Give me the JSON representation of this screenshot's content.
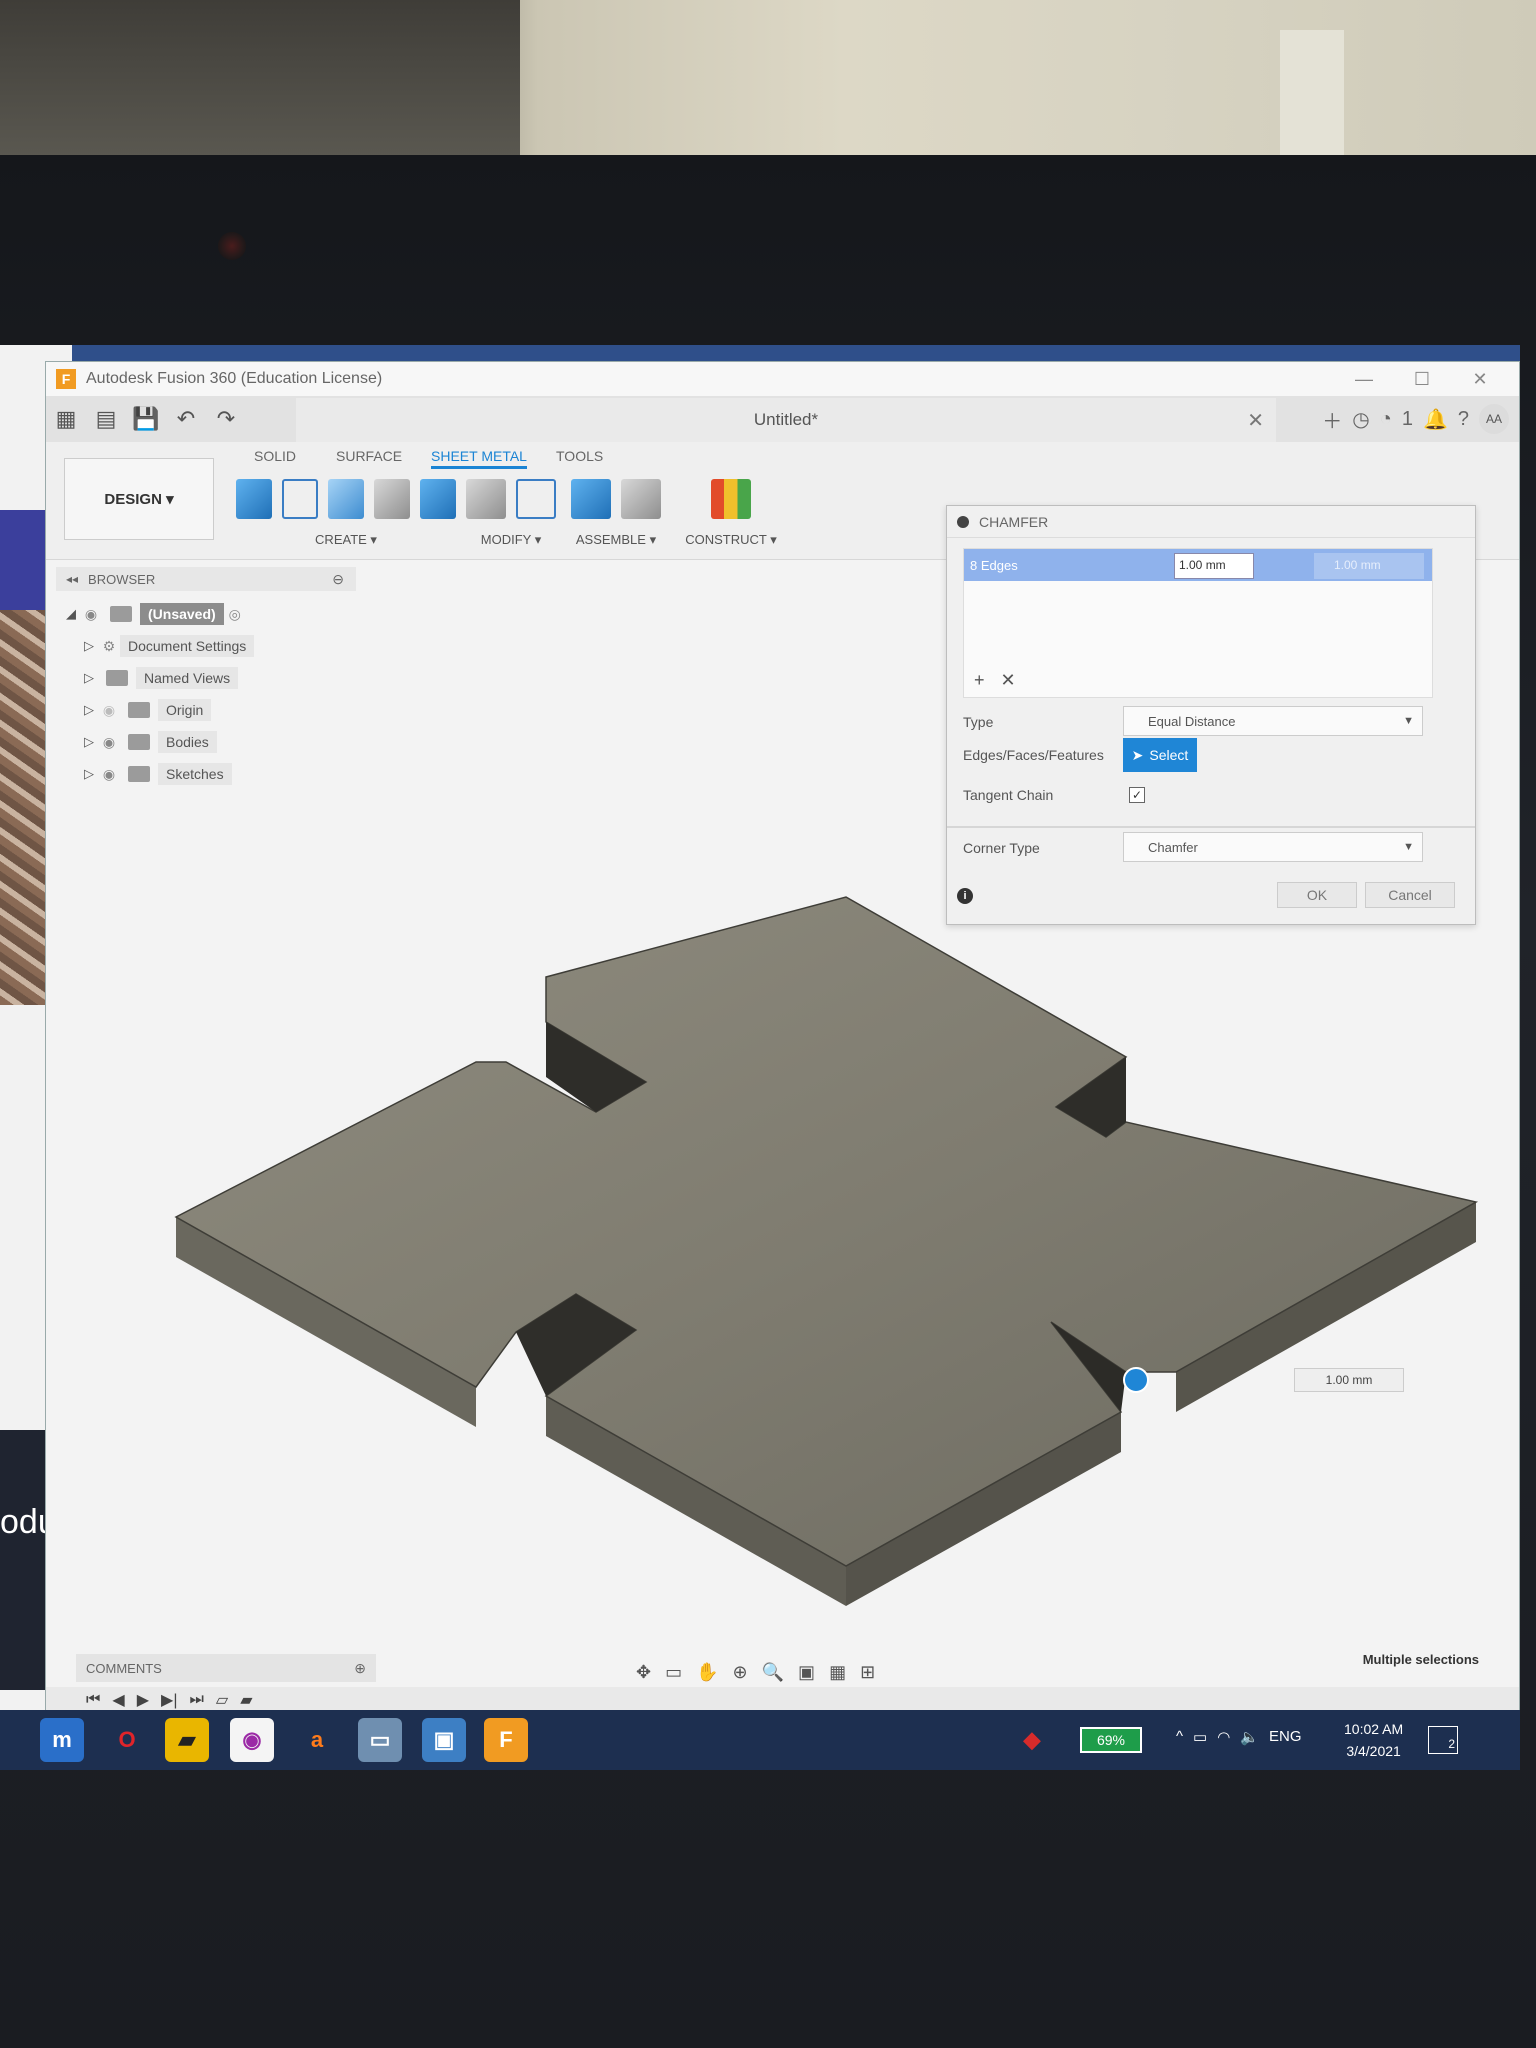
{
  "window": {
    "title": "Autodesk Fusion 360 (Education License)",
    "app_letter": "F"
  },
  "document_tab": {
    "title": "Untitled*"
  },
  "qat_right": {
    "jobs": "1",
    "user": "AA"
  },
  "workspace": {
    "label": "DESIGN ▾"
  },
  "ribbon_tabs": [
    "SOLID",
    "SURFACE",
    "SHEET METAL",
    "TOOLS"
  ],
  "ribbon_groups": {
    "create": "CREATE ▾",
    "modify": "MODIFY ▾",
    "assemble": "ASSEMBLE ▾",
    "construct": "CONSTRUCT ▾"
  },
  "browser": {
    "title": "BROWSER",
    "root": "(Unsaved)",
    "items": [
      "Document Settings",
      "Named Views",
      "Origin",
      "Bodies",
      "Sketches"
    ]
  },
  "chamfer": {
    "title": "CHAMFER",
    "edges_label": "8 Edges",
    "distance": "1.00 mm",
    "distance2": "1.00 mm",
    "type_label": "Type",
    "type_value": "Equal Distance",
    "edges_faces_label": "Edges/Faces/Features",
    "select_label": "Select",
    "tangent_label": "Tangent Chain",
    "corner_label": "Corner Type",
    "corner_value": "Chamfer",
    "ok": "OK",
    "cancel": "Cancel"
  },
  "viewport": {
    "dimension": "1.00 mm",
    "status": "Multiple selections"
  },
  "comments": {
    "label": "COMMENTS"
  },
  "taskbar": {
    "battery": "69%",
    "lang": "ENG",
    "time": "10:02 AM",
    "date": "3/4/2021",
    "notifications": "2"
  },
  "background_app": {
    "fragment": "oduct"
  }
}
